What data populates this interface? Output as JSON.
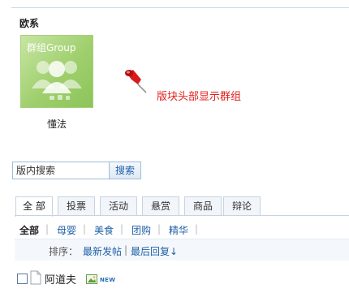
{
  "section": {
    "title": "欧系"
  },
  "group": {
    "avatar_label": "群组Group",
    "name": "懂法"
  },
  "hint": {
    "text": "版块头部显示群组"
  },
  "search": {
    "value": "版内搜索",
    "button_label": "搜索"
  },
  "tabs": [
    {
      "label": "全 部",
      "active": true
    },
    {
      "label": "投票"
    },
    {
      "label": "活动"
    },
    {
      "label": "悬赏"
    },
    {
      "label": "商品"
    },
    {
      "label": "辩论"
    }
  ],
  "filters": [
    {
      "label": "全部",
      "active": true
    },
    {
      "label": "母婴"
    },
    {
      "label": "美食"
    },
    {
      "label": "团购"
    },
    {
      "label": "精华"
    }
  ],
  "sort": {
    "label": "排序：",
    "newest": "最新发帖",
    "separator": "|",
    "last_reply": "最后回复↓"
  },
  "thread": {
    "title": "阿道夫",
    "badge": "NEW"
  },
  "colors": {
    "accent_link": "#1f5fa6",
    "hint_red": "#e0201c",
    "avatar_green": "#9fcf6d"
  }
}
